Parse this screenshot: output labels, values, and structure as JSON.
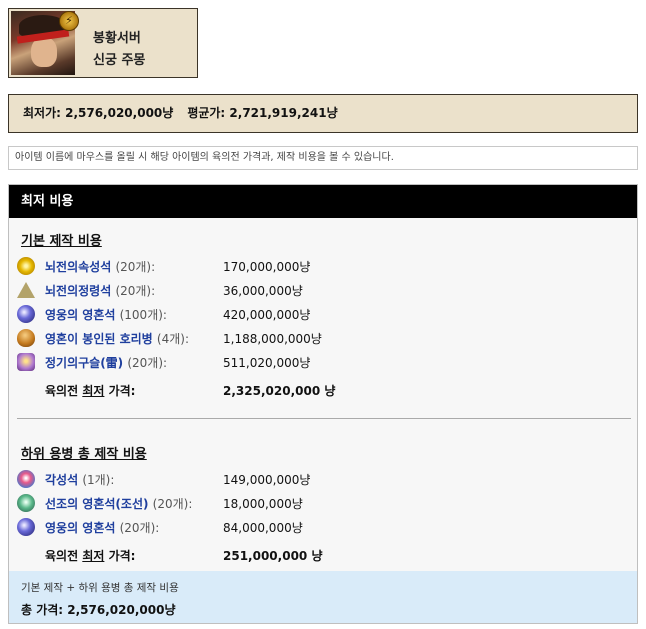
{
  "header": {
    "server": "봉황서버",
    "mercenary": "신궁 주몽",
    "class_badge": "⚡"
  },
  "summary": {
    "min_price": "최저가: 2,576,020,000냥",
    "avg_price": "평균가: 2,721,919,241냥"
  },
  "hint": "아이템 이름에 마우스를 올릴 시 해당 아이템의 육의전 가격과, 제작 비용을 볼 수 있습니다.",
  "panel": {
    "title": "최저 비용",
    "basic": {
      "title": "기본 제작 비용",
      "items": [
        {
          "name": "뇌전의속성석",
          "qty": "(20개):",
          "value": "170,000,000냥",
          "icon": "thunder-stone-icon"
        },
        {
          "name": "뇌전의정령석",
          "qty": "(20개):",
          "value": "36,000,000냥",
          "icon": "spirit-stone-icon"
        },
        {
          "name": "영웅의 영혼석",
          "qty": "(100개):",
          "value": "420,000,000냥",
          "icon": "soul-stone-icon"
        },
        {
          "name": "영혼이 봉인된 호리병",
          "qty": "(4개):",
          "value": "1,188,000,000냥",
          "icon": "sealed-gourd-icon"
        },
        {
          "name": "정기의구슬(雷)",
          "qty": "(20개):",
          "value": "511,020,000냥",
          "icon": "energy-bead-icon"
        }
      ],
      "total_prefix": "육의전 ",
      "total_emph": "최저",
      "total_suffix": " 가격:",
      "total_value": "2,325,020,000 냥"
    },
    "sub": {
      "title": "하위 용병 총 제작 비용",
      "items": [
        {
          "name": "각성석",
          "qty": "(1개):",
          "value": "149,000,000냥",
          "icon": "awakening-stone-icon"
        },
        {
          "name": "선조의 영혼석(조선)",
          "qty": "(20개):",
          "value": "18,000,000냥",
          "icon": "ancestor-soul-stone-icon"
        },
        {
          "name": "영웅의 영혼석",
          "qty": "(20개):",
          "value": "84,000,000냥",
          "icon": "soul-stone-icon"
        }
      ],
      "total_prefix": "육의전 ",
      "total_emph": "최저",
      "total_suffix": " 가격:",
      "total_value": "251,000,000 냥"
    },
    "grand": {
      "caption": "기본 제작 + 하위 용병 총 제작 비용",
      "total": "총 가격: 2,576,020,000냥"
    }
  }
}
